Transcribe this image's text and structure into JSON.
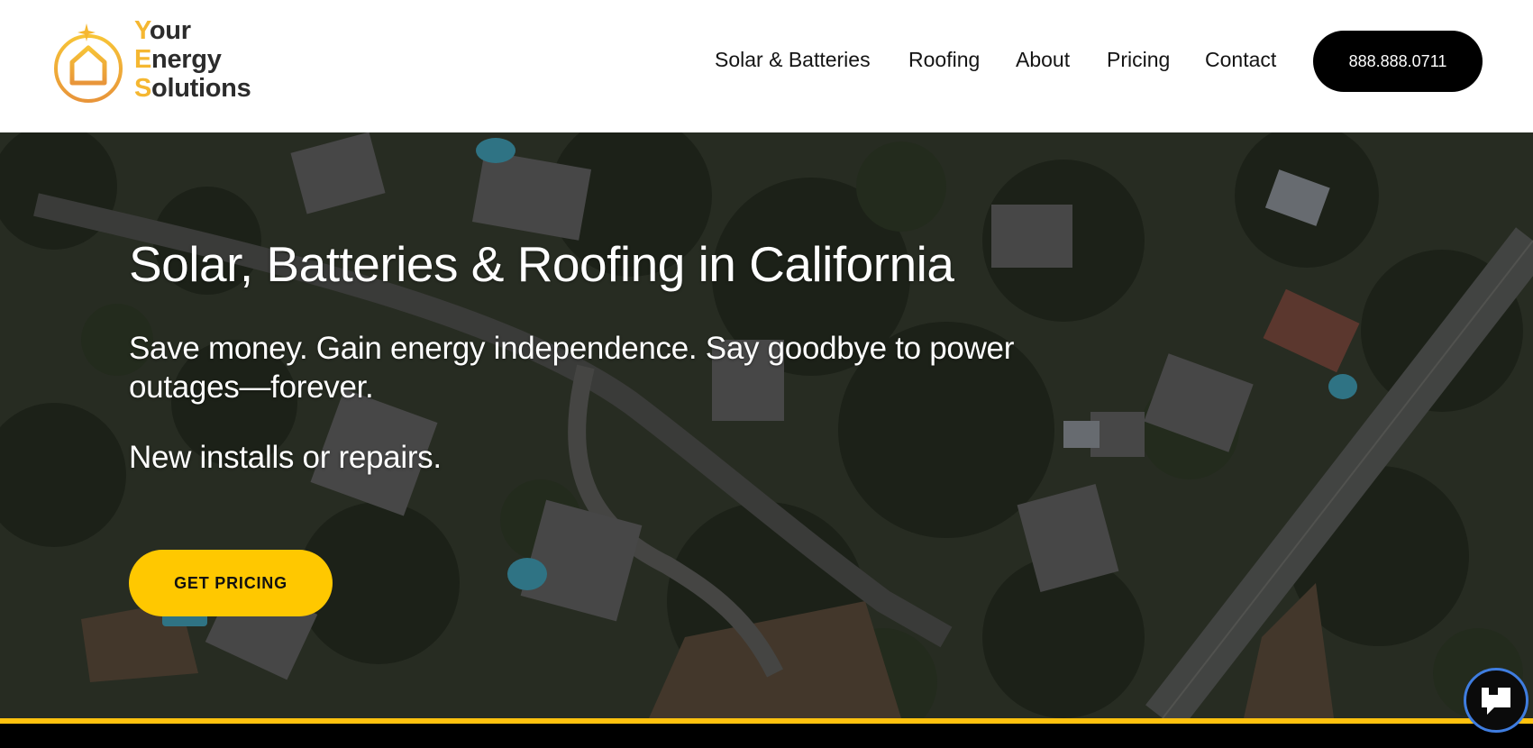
{
  "brand": {
    "lines": [
      {
        "initial": "Y",
        "rest": "our"
      },
      {
        "initial": "E",
        "rest": "nergy"
      },
      {
        "initial": "S",
        "rest": "olutions"
      }
    ],
    "accent_color": "#f5b731",
    "icon": "house-sun-logo-icon"
  },
  "nav": {
    "items": [
      "Solar & Batteries",
      "Roofing",
      "About",
      "Pricing",
      "Contact"
    ],
    "phone_label": "888.888.0711"
  },
  "hero": {
    "title": "Solar, Batteries & Roofing in California",
    "subtitle": "Save money. Gain energy independence. Say goodbye to power outages—forever.",
    "subtitle2": "New installs or repairs.",
    "cta_label": "GET PRICING",
    "background": "aerial-neighborhood-photo"
  },
  "colors": {
    "cta": "#ffc800",
    "phone_button": "#000000",
    "footer_stripe": "#ffc20e",
    "chat_border": "#3f7de0"
  },
  "chat_widget": {
    "icon": "chat-bubble-icon"
  }
}
